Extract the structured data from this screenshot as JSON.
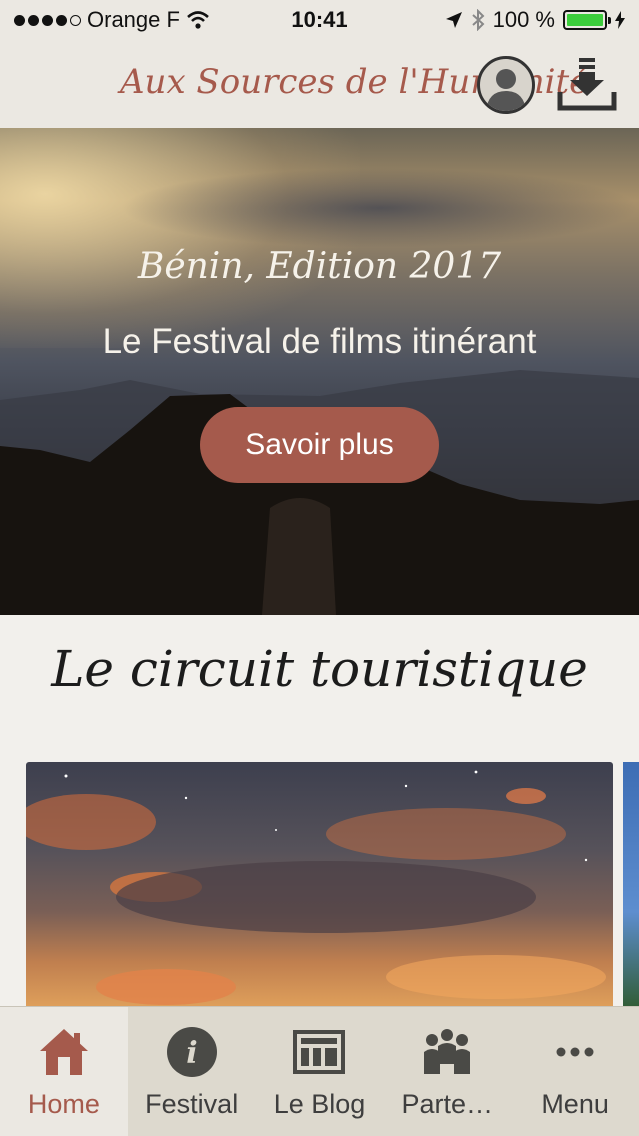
{
  "status_bar": {
    "carrier": "Orange F",
    "time": "10:41",
    "battery": "100 %",
    "battery_level": 1.0
  },
  "header": {
    "title": "Aux Sources de l'Humanité"
  },
  "hero": {
    "subtitle": "Bénin, Edition 2017",
    "title": "Le Festival de films itinérant",
    "button_label": "Savoir plus"
  },
  "section": {
    "heading": "Le circuit touristique"
  },
  "tabs": [
    {
      "label": "Home",
      "icon": "home-icon"
    },
    {
      "label": "Festival",
      "icon": "info-icon"
    },
    {
      "label": "Le Blog",
      "icon": "newspaper-icon"
    },
    {
      "label": "Parte…",
      "icon": "partners-icon"
    },
    {
      "label": "Menu",
      "icon": "more-icon"
    }
  ],
  "colors": {
    "accent": "#a55a4c",
    "header_bg": "#ebe8e2",
    "tabbar_bg": "#ddd9ce"
  }
}
